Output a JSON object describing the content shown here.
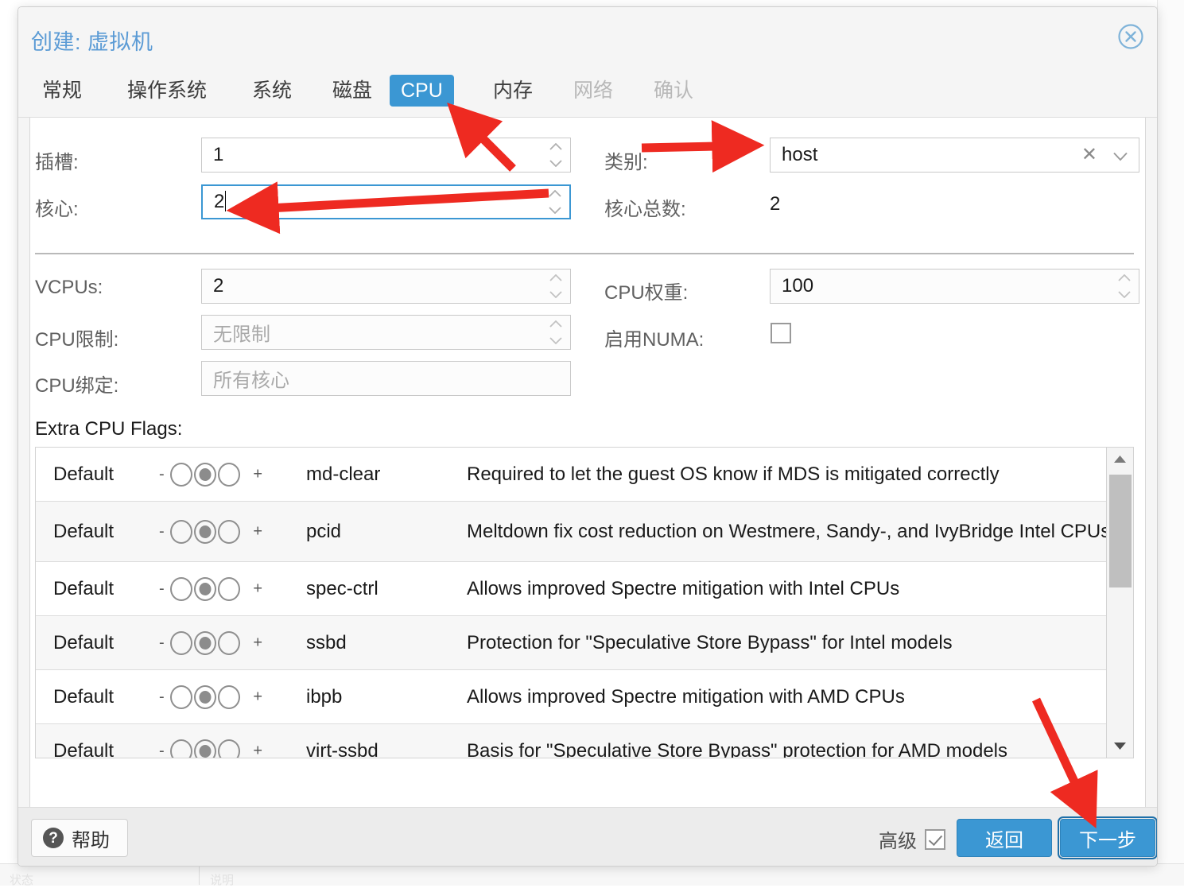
{
  "dialog": {
    "title": "创建: 虚拟机",
    "close_icon": "close-circle-icon"
  },
  "tabs": [
    {
      "label": "常规",
      "state": "normal"
    },
    {
      "label": "操作系统",
      "state": "normal"
    },
    {
      "label": "系统",
      "state": "normal"
    },
    {
      "label": "磁盘",
      "state": "normal"
    },
    {
      "label": "CPU",
      "state": "active"
    },
    {
      "label": "内存",
      "state": "normal"
    },
    {
      "label": "网络",
      "state": "disabled"
    },
    {
      "label": "确认",
      "state": "disabled"
    }
  ],
  "form": {
    "sockets": {
      "label": "插槽:",
      "value": "1"
    },
    "cores": {
      "label": "核心:",
      "value": "2",
      "focused": true
    },
    "type": {
      "label": "类别:",
      "value": "host",
      "clear_icon": "clear-x-icon",
      "caret_icon": "chevron-down-icon"
    },
    "total_cores": {
      "label": "核心总数:",
      "value": "2"
    },
    "vcpus": {
      "label": "VCPUs:",
      "value": "2"
    },
    "cpu_limit": {
      "label": "CPU限制:",
      "placeholder": "无限制"
    },
    "cpu_affinity": {
      "label": "CPU绑定:",
      "placeholder": "所有核心"
    },
    "cpu_units": {
      "label": "CPU权重:",
      "value": "100"
    },
    "enable_numa": {
      "label": "启用NUMA:",
      "checked": false
    }
  },
  "flags": {
    "label": "Extra CPU Flags:",
    "minus_sign": "-",
    "plus_sign": "+",
    "selected_state": "default",
    "rows": [
      {
        "state": "Default",
        "name": "md-clear",
        "desc": "Required to let the guest OS know if MDS is mitigated correctly"
      },
      {
        "state": "Default",
        "name": "pcid",
        "desc": "Meltdown fix cost reduction on Westmere, Sandy-, and IvyBridge Intel CPUs"
      },
      {
        "state": "Default",
        "name": "spec-ctrl",
        "desc": "Allows improved Spectre mitigation with Intel CPUs"
      },
      {
        "state": "Default",
        "name": "ssbd",
        "desc": "Protection for \"Speculative Store Bypass\" for Intel models"
      },
      {
        "state": "Default",
        "name": "ibpb",
        "desc": "Allows improved Spectre mitigation with AMD CPUs"
      },
      {
        "state": "Default",
        "name": "virt-ssbd",
        "desc": "Basis for \"Speculative Store Bypass\" protection for AMD models"
      }
    ],
    "scroll_up_icon": "scroll-up-arrow-icon",
    "scroll_down_icon": "scroll-down-arrow-icon"
  },
  "footer": {
    "help_label": "帮助",
    "help_icon": "question-mark-icon",
    "advanced_label": "高级",
    "advanced_checked": true,
    "back_label": "返回",
    "next_label": "下一步"
  },
  "colors": {
    "accent": "#3b97d3",
    "title": "#5b9bd5",
    "annotation": "#ee2a21"
  }
}
